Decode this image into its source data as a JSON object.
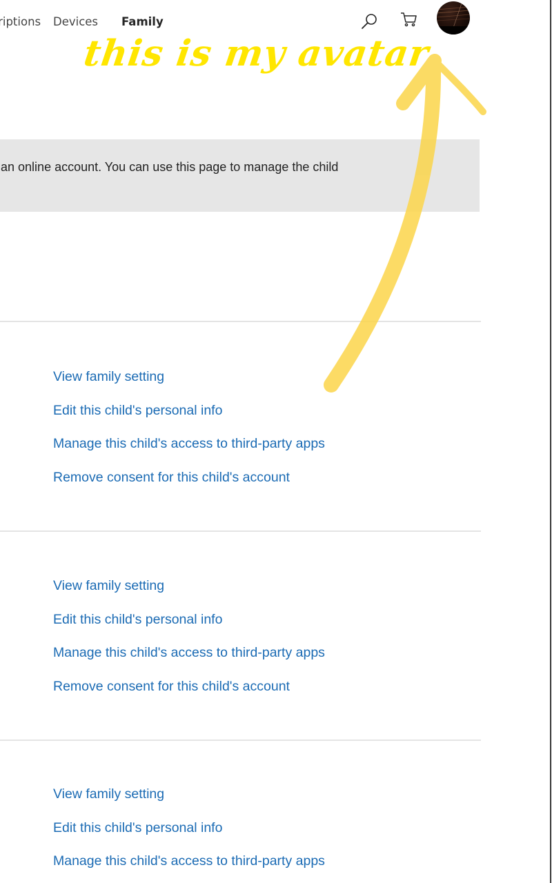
{
  "nav": {
    "items": [
      {
        "label": "Subscriptions",
        "visible_label": "tions"
      },
      {
        "label": "Devices"
      },
      {
        "label": "Family",
        "active": true
      }
    ],
    "icons": {
      "search": "search-icon",
      "cart": "cart-icon",
      "avatar": "avatar"
    }
  },
  "info_banner": {
    "text": "g an online account. You can use this page to manage the child"
  },
  "children": [
    {
      "links": [
        "View family setting",
        "Edit this child's personal info",
        "Manage this child's access to third-party apps",
        "Remove consent for this child's account"
      ]
    },
    {
      "links": [
        "View family setting",
        "Edit this child's personal info",
        "Manage this child's access to third-party apps",
        "Remove consent for this child's account"
      ]
    },
    {
      "links": [
        "View family setting",
        "Edit this child's personal info",
        "Manage this child's access to third-party apps"
      ]
    }
  ],
  "annotation": {
    "text": "this is my avatar",
    "color": "#ffe600",
    "arrow_color": "#fbd54a"
  },
  "colors": {
    "link": "#1b6bb4",
    "banner_bg": "#e6e6e6",
    "separator": "#e4e4e4"
  }
}
